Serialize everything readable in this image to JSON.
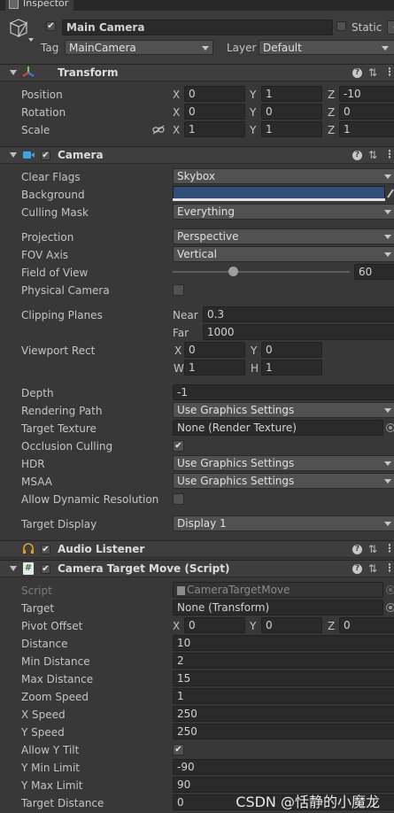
{
  "tab": {
    "title": "Inspector"
  },
  "header": {
    "object_name": "Main Camera",
    "static_label": "Static",
    "tag_label": "Tag",
    "tag_value": "MainCamera",
    "layer_label": "Layer",
    "layer_value": "Default"
  },
  "transform": {
    "title": "Transform",
    "rows": [
      {
        "label": "Position",
        "x": "0",
        "y": "1",
        "z": "-10"
      },
      {
        "label": "Rotation",
        "x": "0",
        "y": "0",
        "z": "0"
      },
      {
        "label": "Scale",
        "x": "1",
        "y": "1",
        "z": "1"
      }
    ],
    "axes": {
      "x": "X",
      "y": "Y",
      "z": "Z"
    }
  },
  "camera": {
    "title": "Camera",
    "clear_flags": {
      "label": "Clear Flags",
      "value": "Skybox"
    },
    "background": {
      "label": "Background",
      "color": "#314D79"
    },
    "culling_mask": {
      "label": "Culling Mask",
      "value": "Everything"
    },
    "projection": {
      "label": "Projection",
      "value": "Perspective"
    },
    "fov_axis": {
      "label": "FOV Axis",
      "value": "Vertical"
    },
    "field_of_view": {
      "label": "Field of View",
      "value": "60",
      "slider_fraction": 0.34
    },
    "physical_camera": {
      "label": "Physical Camera"
    },
    "clipping_planes": {
      "label": "Clipping Planes",
      "near_label": "Near",
      "near": "0.3",
      "far_label": "Far",
      "far": "1000"
    },
    "viewport_rect": {
      "label": "Viewport Rect",
      "x_label": "X",
      "x": "0",
      "y_label": "Y",
      "y": "0",
      "w_label": "W",
      "w": "1",
      "h_label": "H",
      "h": "1"
    },
    "depth": {
      "label": "Depth",
      "value": "-1"
    },
    "rendering_path": {
      "label": "Rendering Path",
      "value": "Use Graphics Settings"
    },
    "target_texture": {
      "label": "Target Texture",
      "value": "None (Render Texture)"
    },
    "occlusion_culling": {
      "label": "Occlusion Culling"
    },
    "hdr": {
      "label": "HDR",
      "value": "Use Graphics Settings"
    },
    "msaa": {
      "label": "MSAA",
      "value": "Use Graphics Settings"
    },
    "allow_dynamic_resolution": {
      "label": "Allow Dynamic Resolution"
    },
    "target_display": {
      "label": "Target Display",
      "value": "Display 1"
    }
  },
  "audio_listener": {
    "title": "Audio Listener"
  },
  "script": {
    "title": "Camera Target Move (Script)",
    "script_field": {
      "label": "Script",
      "value": "CameraTargetMove"
    },
    "target": {
      "label": "Target",
      "value": "None (Transform)"
    },
    "pivot_offset": {
      "label": "Pivot Offset",
      "x": "0",
      "y": "0",
      "z": "0"
    },
    "fields": [
      {
        "label": "Distance",
        "value": "10"
      },
      {
        "label": "Min Distance",
        "value": "2"
      },
      {
        "label": "Max Distance",
        "value": "15"
      },
      {
        "label": "Zoom Speed",
        "value": "1"
      },
      {
        "label": "X Speed",
        "value": "250"
      },
      {
        "label": "Y Speed",
        "value": "250"
      }
    ],
    "allow_y_tilt": {
      "label": "Allow Y Tilt"
    },
    "fields2": [
      {
        "label": "Y Min Limit",
        "value": "-90"
      },
      {
        "label": "Y Max Limit",
        "value": "90"
      },
      {
        "label": "Target Distance",
        "value": "0"
      }
    ]
  },
  "watermark": "CSDN @恬静的小魔龙",
  "colors": {
    "panel": "#383838",
    "section": "#3E3E3E",
    "field": "#2A2A2A",
    "accent_blue": "#314D79",
    "camera_icon": "#3DA6E0",
    "audio_icon": "#E0A020",
    "script_icon": "#4CAF50"
  }
}
